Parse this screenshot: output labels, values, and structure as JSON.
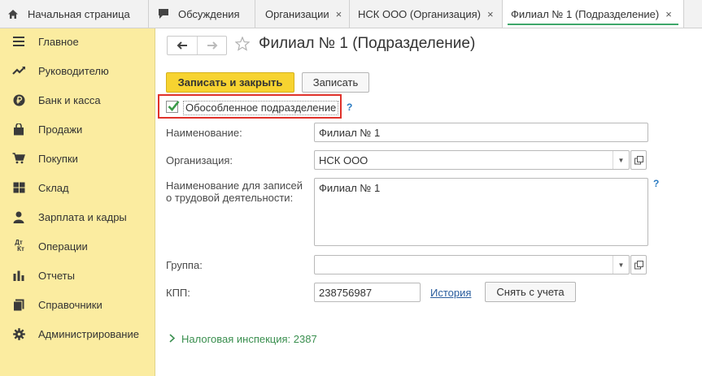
{
  "tabs": [
    {
      "label": "Начальная страница",
      "icon": "home-icon",
      "closable": false,
      "active": false
    },
    {
      "label": "Обсуждения",
      "icon": "chat-icon",
      "closable": false,
      "active": false
    },
    {
      "label": "Организации",
      "closable": true,
      "active": false
    },
    {
      "label": "НСК ООО (Организация)",
      "closable": true,
      "active": false
    },
    {
      "label": "Филиал № 1 (Подразделение)",
      "closable": true,
      "active": true
    }
  ],
  "tab_close_glyph": "×",
  "sidebar": {
    "items": [
      {
        "label": "Главное",
        "icon": "menu-lines-icon"
      },
      {
        "label": "Руководителю",
        "icon": "trend-icon"
      },
      {
        "label": "Банк и касса",
        "icon": "ruble-icon"
      },
      {
        "label": "Продажи",
        "icon": "shopping-bag-icon"
      },
      {
        "label": "Покупки",
        "icon": "cart-icon"
      },
      {
        "label": "Склад",
        "icon": "warehouse-grid-icon"
      },
      {
        "label": "Зарплата и кадры",
        "icon": "person-icon"
      },
      {
        "label": "Операции",
        "icon": "debit-credit-icon"
      },
      {
        "label": "Отчеты",
        "icon": "bar-chart-icon"
      },
      {
        "label": "Справочники",
        "icon": "book-icon"
      },
      {
        "label": "Администрирование",
        "icon": "gear-icon"
      }
    ],
    "dtkt_top": "Дт",
    "dtkt_bottom": "Кт"
  },
  "header": {
    "title": "Филиал № 1 (Подразделение)"
  },
  "toolbar": {
    "save_close_label": "Записать и закрыть",
    "save_label": "Записать"
  },
  "form": {
    "separate_checkbox": {
      "label": "Обособленное подразделение",
      "checked": true
    },
    "help_glyph": "?",
    "name": {
      "label": "Наименование:",
      "value": "Филиал № 1"
    },
    "organization": {
      "label": "Организация:",
      "value": "НСК ООО"
    },
    "labor_name": {
      "label_line1": "Наименование для записей",
      "label_line2": "о трудовой деятельности:",
      "value": "Филиал № 1"
    },
    "group": {
      "label": "Группа:",
      "value": ""
    },
    "kpp": {
      "label": "КПП:",
      "value": "238756987",
      "history_link": "История",
      "deregister_label": "Снять с учета"
    },
    "tax_inspection": {
      "label": "Налоговая инспекция: 2387"
    }
  },
  "colors": {
    "sidebar_bg": "#fbeca0",
    "primary_button": "#f7d330",
    "highlight_border": "#e0322b",
    "active_tab_underline": "#3fa76b",
    "help": "#2a7bc2",
    "tax_link": "#3a8f4f"
  }
}
